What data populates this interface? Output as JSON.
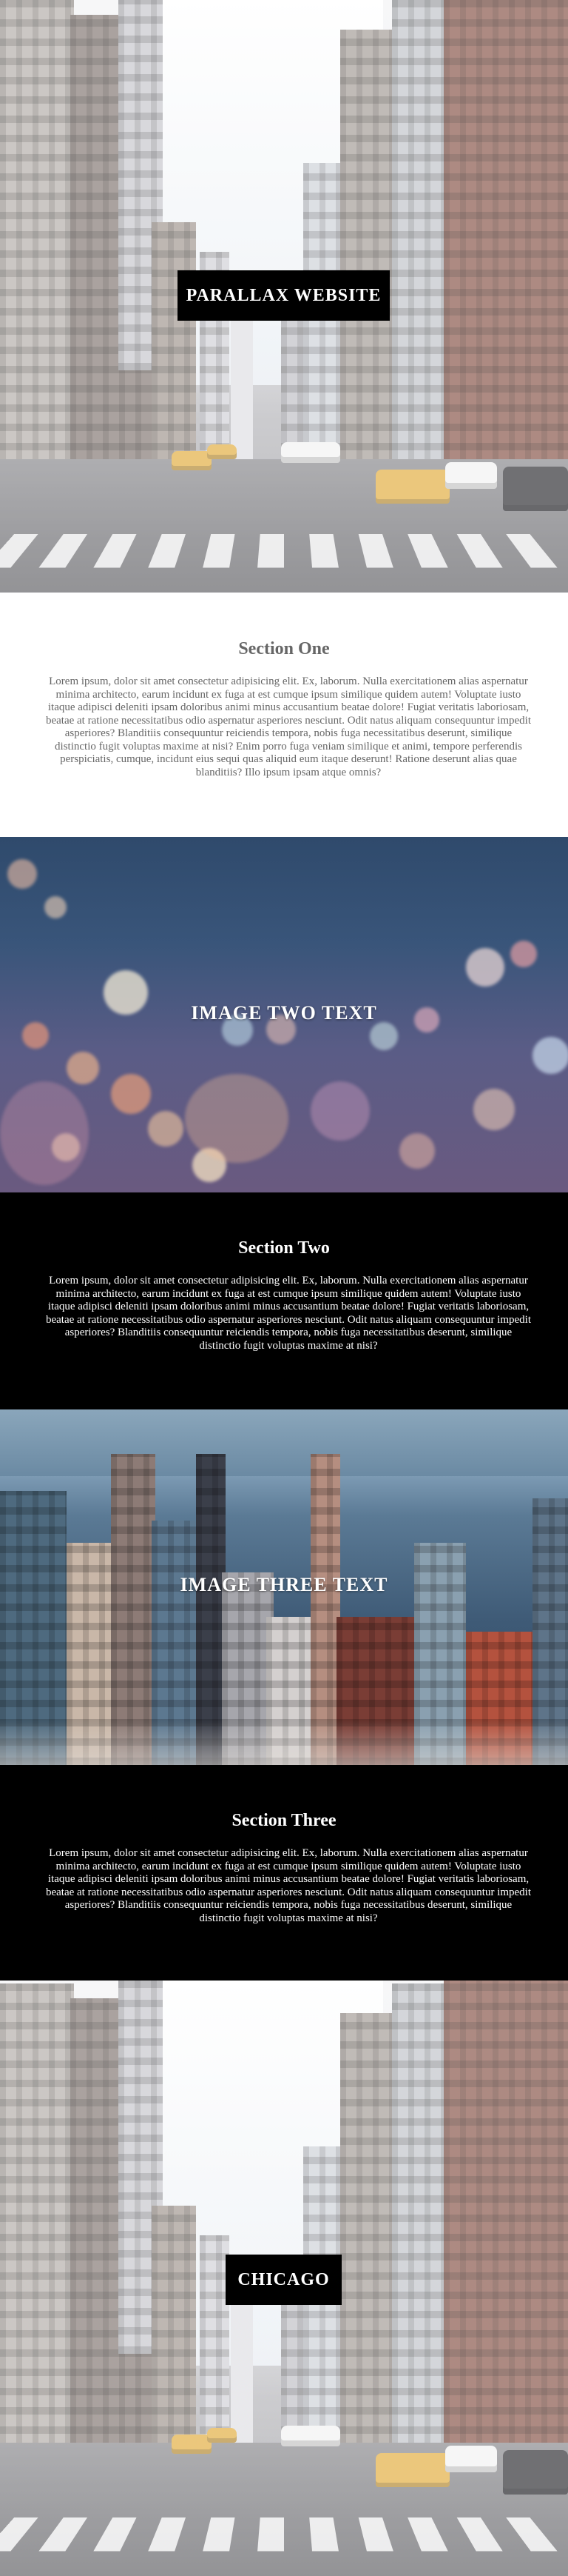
{
  "hero": {
    "title": "Parallax Website"
  },
  "section_one": {
    "heading": "Section One",
    "body": "Lorem ipsum, dolor sit amet consectetur adipisicing elit. Ex, laborum. Nulla exercitationem alias aspernatur minima architecto, earum incidunt ex fuga at est cumque ipsum similique quidem autem! Voluptate iusto itaque adipisci deleniti ipsam doloribus animi minus accusantium beatae dolore! Fugiat veritatis laboriosam, beatae at ratione necessitatibus odio aspernatur asperiores nesciunt. Odit natus aliquam consequuntur impedit asperiores? Blanditiis consequuntur reiciendis tempora, nobis fuga necessitatibus deserunt, similique distinctio fugit voluptas maxime at nisi? Enim porro fuga veniam similique et animi, tempore perferendis perspiciatis, cumque, incidunt eius sequi quas aliquid eum itaque deserunt! Ratione deserunt alias quae blanditiis? Illo ipsum ipsam atque omnis?"
  },
  "image_two": {
    "text": "Image Two Text"
  },
  "section_two": {
    "heading": "Section Two",
    "body": "Lorem ipsum, dolor sit amet consectetur adipisicing elit. Ex, laborum. Nulla exercitationem alias aspernatur minima architecto, earum incidunt ex fuga at est cumque ipsum similique quidem autem! Voluptate iusto itaque adipisci deleniti ipsam doloribus animi minus accusantium beatae dolore! Fugiat veritatis laboriosam, beatae at ratione necessitatibus odio aspernatur asperiores nesciunt. Odit natus aliquam consequuntur impedit asperiores? Blanditiis consequuntur reiciendis tempora, nobis fuga necessitatibus deserunt, similique distinctio fugit voluptas maxime at nisi?"
  },
  "image_three": {
    "text": "Image Three Text"
  },
  "section_three": {
    "heading": "Section Three",
    "body": "Lorem ipsum, dolor sit amet consectetur adipisicing elit. Ex, laborum. Nulla exercitationem alias aspernatur minima architecto, earum incidunt ex fuga at est cumque ipsum similique quidem autem! Voluptate iusto itaque adipisci deleniti ipsam doloribus animi minus accusantium beatae dolore! Fugiat veritatis laboriosam, beatae at ratione necessitatibus odio aspernatur asperiores nesciunt. Odit natus aliquam consequuntur impedit asperiores? Blanditiis consequuntur reiciendis tempora, nobis fuga necessitatibus deserunt, similique distinctio fugit voluptas maxime at nisi?"
  },
  "footer_image": {
    "text": "Chicago"
  },
  "colors": {
    "label_background": "#000000",
    "label_text": "#ffffff",
    "section_one_text": "#666666",
    "dark_section_background": "#000000"
  }
}
